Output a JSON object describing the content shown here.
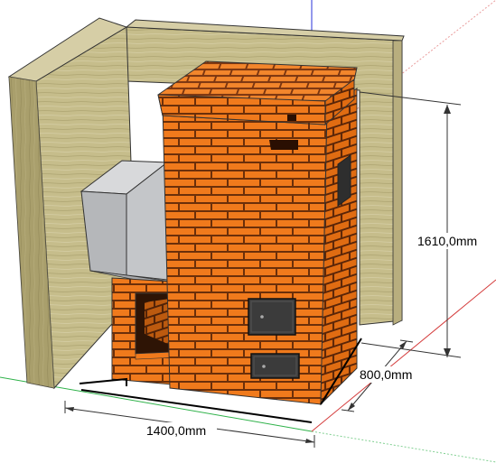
{
  "scene": {
    "description_labels": {
      "width_dimension": "1400,0mm",
      "depth_dimension": "800,0mm",
      "height_dimension": "1610,0mm"
    },
    "colors": {
      "background": "#ffffff",
      "wall_front": "#c9bf8e",
      "wall_side": "#a69d6c",
      "wall_top": "#d4cca3",
      "brick": "#f07a1c",
      "mortar": "#6b2f0a",
      "tank": "#b9bbbe",
      "door": "#3b3b3b",
      "axis_red": "#d43b3b",
      "axis_green": "#2fb24a",
      "axis_blue": "#2a32d8"
    }
  }
}
